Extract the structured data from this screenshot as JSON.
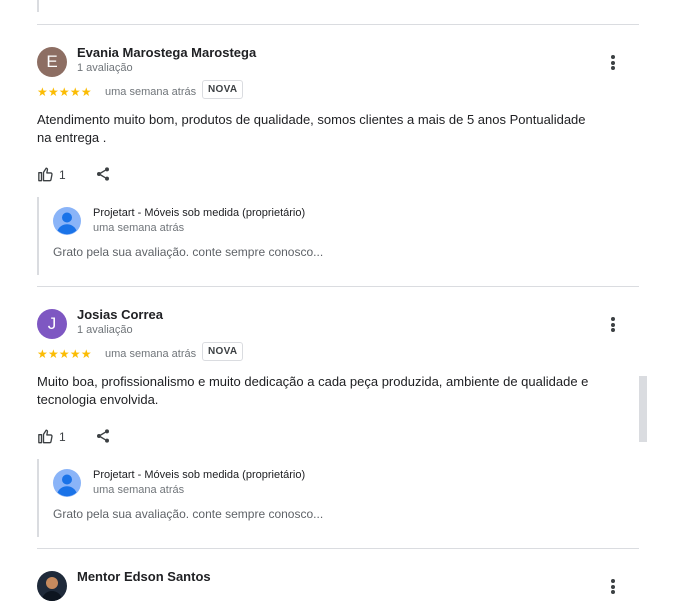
{
  "reviews": [
    {
      "avatar_letter": "E",
      "avatar_color": "#8d6e63",
      "name": "Evania Marostega Marostega",
      "review_count": "1 avaliação",
      "stars": "★★★★★",
      "rating": 5,
      "time": "uma semana atrás",
      "badge": "NOVA",
      "text": "Atendimento muito bom, produtos de qualidade, somos clientes a mais de 5 anos Pontualidade na entrega .",
      "likes": "1",
      "reply": {
        "owner": "Projetart - Móveis sob medida (proprietário)",
        "time": "uma semana atrás",
        "text": "Grato pela sua avaliação. conte sempre conosco..."
      }
    },
    {
      "avatar_letter": "J",
      "avatar_color": "#7e57c2",
      "name": "Josias Correa",
      "review_count": "1 avaliação",
      "stars": "★★★★★",
      "rating": 5,
      "time": "uma semana atrás",
      "badge": "NOVA",
      "text": "Muito boa, profissionalismo e muito dedicação a cada peça produzida, ambiente de qualidade e tecnologia envolvida.",
      "likes": "1",
      "reply": {
        "owner": "Projetart - Móveis sob medida (proprietário)",
        "time": "uma semana atrás",
        "text": "Grato pela sua avaliação. conte sempre conosco..."
      }
    },
    {
      "name": "Mentor Edson Santos"
    }
  ],
  "colors": {
    "star": "#fbbc04",
    "divider": "#dadce0",
    "owner_avatar": "#8ab4f8"
  },
  "icons": {
    "like": "thumb-up-icon",
    "share": "share-icon",
    "more": "more-vert-icon"
  }
}
